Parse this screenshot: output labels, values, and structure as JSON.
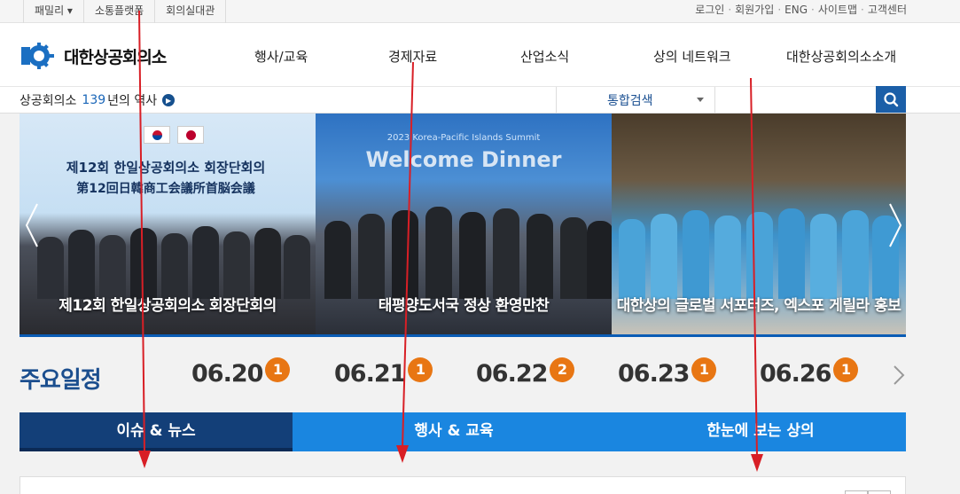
{
  "topbar": {
    "family": [
      "패밀리 ▾",
      "소통플랫폼",
      "회의실대관"
    ],
    "util": [
      "로그인",
      "회원가입",
      "ENG",
      "사이트맵",
      "고객센터"
    ]
  },
  "header": {
    "logo_text": "대한상공회의소",
    "nav": [
      "행사/교육",
      "경제자료",
      "산업소식",
      "상의 네트워크",
      "대한상공회의소소개"
    ]
  },
  "subbar": {
    "history_prefix": "상공회의소",
    "history_num": "139",
    "history_suffix": "년의 역사",
    "search_scope": "통합검색",
    "search_placeholder": ""
  },
  "banner": {
    "slides": [
      {
        "caption": "제12회 한일상공회의소 회장단회의",
        "headline1": "제12회 한일상공회의소 회장단회의",
        "headline2": "第12回日韓商工会議所首脳会議"
      },
      {
        "caption": "태평양도서국 정상 환영만찬",
        "summit": "2023 Korea-Pacific Islands Summit",
        "welcome": "Welcome Dinner"
      },
      {
        "caption": "대한상의 글로벌 서포터즈, 엑스포 게릴라 홍보"
      }
    ]
  },
  "schedule": {
    "title": "주요일정",
    "items": [
      {
        "date": "06.20",
        "count": "1"
      },
      {
        "date": "06.21",
        "count": "1"
      },
      {
        "date": "06.22",
        "count": "2"
      },
      {
        "date": "06.23",
        "count": "1"
      },
      {
        "date": "06.26",
        "count": "1"
      }
    ]
  },
  "tabs": [
    "이슈 & 뉴스",
    "행사 & 교육",
    "한눈에 보는 상의"
  ],
  "colors": {
    "brand_blue": "#1b4e8e",
    "tab_active": "#133f78",
    "tab_inactive": "#1a86e0",
    "badge": "#e87613",
    "annotation_arrow": "#d81f26"
  },
  "icons": [
    "search-icon",
    "play-circle-icon",
    "chevron-left-icon",
    "chevron-right-icon",
    "dropdown-caret-icon"
  ]
}
